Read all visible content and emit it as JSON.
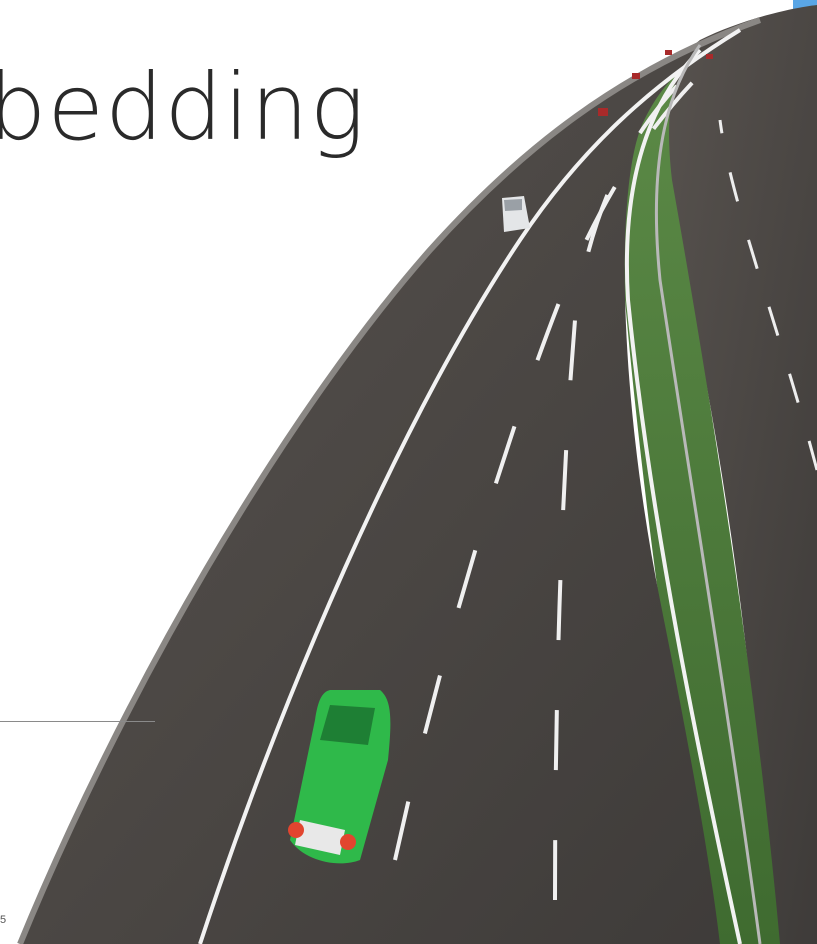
{
  "slide": {
    "title_fragment": "bedding",
    "page_number": "5"
  },
  "colors": {
    "accent_bar": "#5aa6e6",
    "asphalt": "#4b4846",
    "grass": "#4d7a3a",
    "car_green": "#2fb94a",
    "tail_light": "#e2452f"
  },
  "scene": {
    "subject": "highway-render",
    "vehicles": [
      "green-car",
      "white-van",
      "distant-red-cars"
    ]
  }
}
